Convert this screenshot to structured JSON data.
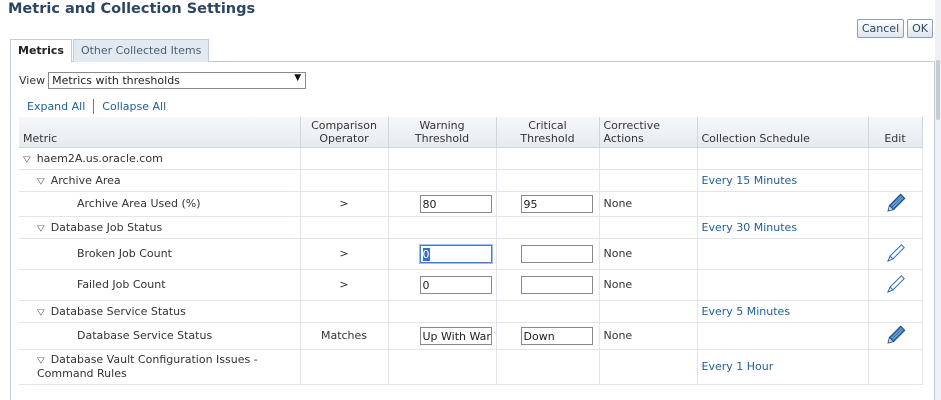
{
  "page": {
    "title": "Metric and Collection Settings",
    "cancel_label": "Cancel",
    "ok_label": "OK"
  },
  "tabs": [
    {
      "label": "Metrics",
      "active": true
    },
    {
      "label": "Other Collected Items",
      "active": false
    }
  ],
  "view": {
    "label": "View",
    "selected": "Metrics with thresholds"
  },
  "tree_actions": {
    "expand_all": "Expand All",
    "collapse_all": "Collapse All"
  },
  "columns": {
    "metric": "Metric",
    "comparison_operator": "Comparison Operator",
    "warning_threshold": "Warning Threshold",
    "critical_threshold": "Critical Threshold",
    "corrective_actions": "Corrective Actions",
    "collection_schedule": "Collection Schedule",
    "edit": "Edit"
  },
  "rows": [
    {
      "metric": "haem2A.us.oracle.com",
      "schedule": ""
    },
    {
      "metric": "Archive Area",
      "schedule": "Every 15 Minutes"
    },
    {
      "metric": "Archive Area Used (%)",
      "operator": ">",
      "warning": "80",
      "critical": "95",
      "actions": "None",
      "edit_icon": "pencil-detailed-icon"
    },
    {
      "metric": "Database Job Status",
      "schedule": "Every 30 Minutes"
    },
    {
      "metric": "Broken Job Count",
      "operator": ">",
      "warning": "0",
      "critical": "",
      "actions": "None",
      "edit_icon": "pencil-icon"
    },
    {
      "metric": "Failed Job Count",
      "operator": ">",
      "warning": "0",
      "critical": "",
      "actions": "None",
      "edit_icon": "pencil-icon"
    },
    {
      "metric": "Database Service Status",
      "schedule": "Every 5 Minutes"
    },
    {
      "metric": "Database Service Status",
      "operator": "Matches",
      "warning": "Up With Warn",
      "critical": "Down",
      "actions": "None",
      "edit_icon": "pencil-detailed-icon"
    },
    {
      "metric": "Database Vault Configuration Issues - Command Rules",
      "schedule": "Every 1 Hour"
    }
  ],
  "colors": {
    "title": "#2b4663",
    "link": "#1f5e96",
    "pencil": "#2e6ab0",
    "header_bg": "#e7ebf0",
    "tab_inactive_bg": "#e3e9f0"
  }
}
